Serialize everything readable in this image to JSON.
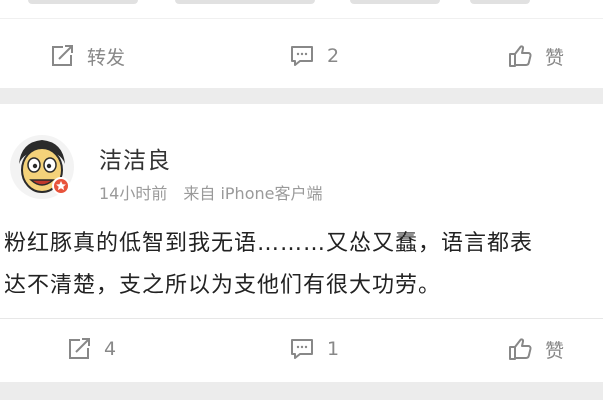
{
  "post1": {
    "actions": {
      "repost": {
        "label": "转发",
        "icon": "repost-icon"
      },
      "comment": {
        "count": "2",
        "icon": "comment-icon"
      },
      "like": {
        "label": "赞",
        "icon": "thumbs-up-icon"
      }
    }
  },
  "post2": {
    "author": {
      "name": "洁洁良",
      "avatar": "cartoon-avatar-icon"
    },
    "meta": {
      "time": "14小时前",
      "source": "来自 iPhone客户端"
    },
    "content": {
      "line1": "粉红豚真的低智到我无语………又怂又蠢，语言都表",
      "line2": "达不清楚，支之所以为支他们有很大功劳。"
    },
    "actions": {
      "repost": {
        "count": "4",
        "icon": "repost-icon"
      },
      "comment": {
        "count": "1",
        "icon": "comment-icon"
      },
      "like": {
        "label": "赞",
        "icon": "thumbs-up-icon"
      }
    }
  },
  "colors": {
    "page_bg": "#ececec",
    "card_bg": "#ffffff",
    "action_text": "#888888",
    "text": "#222222",
    "meta": "#9a9a9a"
  }
}
